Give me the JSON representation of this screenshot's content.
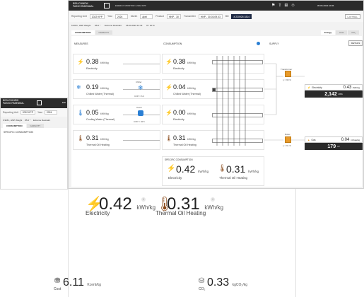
{
  "brand": {
    "line1": "BIRLICHINEW",
    "line2": "PASSO RMIENMAL"
  },
  "breadcrumb": "ENERGY MONITOR  /  2022 KPP",
  "header_right": "05.06.2024 10:06",
  "filters": {
    "reporting_unit_label": "Reporting Unit",
    "reporting_unit": "2022 KPP",
    "year_label": "Year",
    "year": "2024",
    "month_label": "Month",
    "month": "April",
    "product_label": "Product",
    "product": "HNP - 30",
    "transmitter_label": "Transmitter",
    "transmitter": "HNP - 30.03.09.03",
    "bill_label": "Bill",
    "bill": "# 220926 1814",
    "last_button": "LAST BILL"
  },
  "left_filters": {
    "reporting_unit_label": "Reporting Unit",
    "reporting_unit": "2022 KPP",
    "year_label": "Year",
    "year": "2024"
  },
  "status": {
    "run": "6.968 t, HNP Weight",
    "extra": "85.0 ⁿ",
    "state": "Extreme Restraint",
    "date": "25.04.2024 12:34",
    "progress": "PI: 20 %"
  },
  "left_status": {
    "run": "6.968 t, HNP Weight",
    "extra": "85.0 ⁿ",
    "state": "Extreme Restraint"
  },
  "tabs": {
    "consumption": "CONSUMPTION",
    "capacity": "CAPACITY"
  },
  "view_tabs": {
    "energy": "Energy",
    "cost": "Cost",
    "co2": "CO₂"
  },
  "left_content": {
    "title": "SPECIFIC CONSUMPTION"
  },
  "columns": {
    "measures": "MEASURES",
    "consumption": "CONSUMPTION",
    "supply": "SUPPLY",
    "details_button": "DETAILS"
  },
  "measures": [
    {
      "value": "0.38",
      "unit": "kWh/kg",
      "label": "Electricity",
      "icon": "plug-icon"
    },
    {
      "value": "0.19",
      "unit": "kWh/kg",
      "label": "Chilled Water (Thermal)",
      "icon": "snowflake-icon"
    },
    {
      "value": "0.05",
      "unit": "kWh/kg",
      "label": "Cooling Water (Thermal)",
      "icon": "thermometer-icon"
    },
    {
      "value": "0.31",
      "unit": "kWh/kg",
      "label": "Thermal Oil Heating",
      "icon": "flame-icon"
    }
  ],
  "converters": [
    {
      "top": "Chiller",
      "bottom": "COP = 6.3"
    },
    {
      "top": "Tower",
      "bottom": "COP = 32.5"
    }
  ],
  "consumption": [
    {
      "value": "0.38",
      "unit": "kWh/kg",
      "label": "Electricity",
      "bar_fraction": 0.0
    },
    {
      "value": "0.04",
      "unit": "kWh/kg",
      "label": "Chilled Water (Thermal)",
      "bar_fraction": 0.05
    },
    {
      "value": "0.00",
      "unit": "kWh/kg",
      "label": "Electricity",
      "bar_fraction": 0.0
    },
    {
      "value": "0.31",
      "unit": "kWh/kg",
      "label": "Thermal Oil Heating",
      "bar_fraction": 0.0
    }
  ],
  "specific_title": "SPECIFIC CONSUMPTION",
  "specific": [
    {
      "value": "0.42",
      "unit": "kWh/kg",
      "label": "Electricity"
    },
    {
      "value": "0.31",
      "unit": "kWh/kg",
      "label": "Thermal Oil Heating"
    }
  ],
  "supply": [
    {
      "node": "Transformer",
      "node_sub": "η = 98 %",
      "label": "Electricity",
      "value": "0.43",
      "unit": "kWh/kg",
      "total": "2,142",
      "total_unit": "kWh"
    },
    {
      "node": "Boiler",
      "node_sub": "η = 91 %",
      "label": "Gas",
      "value": "0.04",
      "unit": "m³Gas/kg",
      "total": "179",
      "total_unit": "m³"
    }
  ],
  "bottom": {
    "big": [
      {
        "value": "0.42",
        "unit": "kWh/kg",
        "label": "Electricity"
      },
      {
        "value": "0.31",
        "unit": "kWh/kg",
        "label": "Thermal Oil Heating"
      }
    ],
    "small": [
      {
        "value": "6.11",
        "unit": "Kcent/kg",
        "label": "Cost"
      },
      {
        "value": "0.33",
        "unit": "kgCO₂/kg",
        "label": "CO₂"
      }
    ]
  },
  "colors": {
    "dark": "#2b2b2b",
    "accent": "#1f2a44",
    "icon_gold": "#a8862a",
    "icon_blue": "#2a7fd4",
    "icon_brown": "#8a4a1a",
    "orange": "#e89a2a"
  }
}
